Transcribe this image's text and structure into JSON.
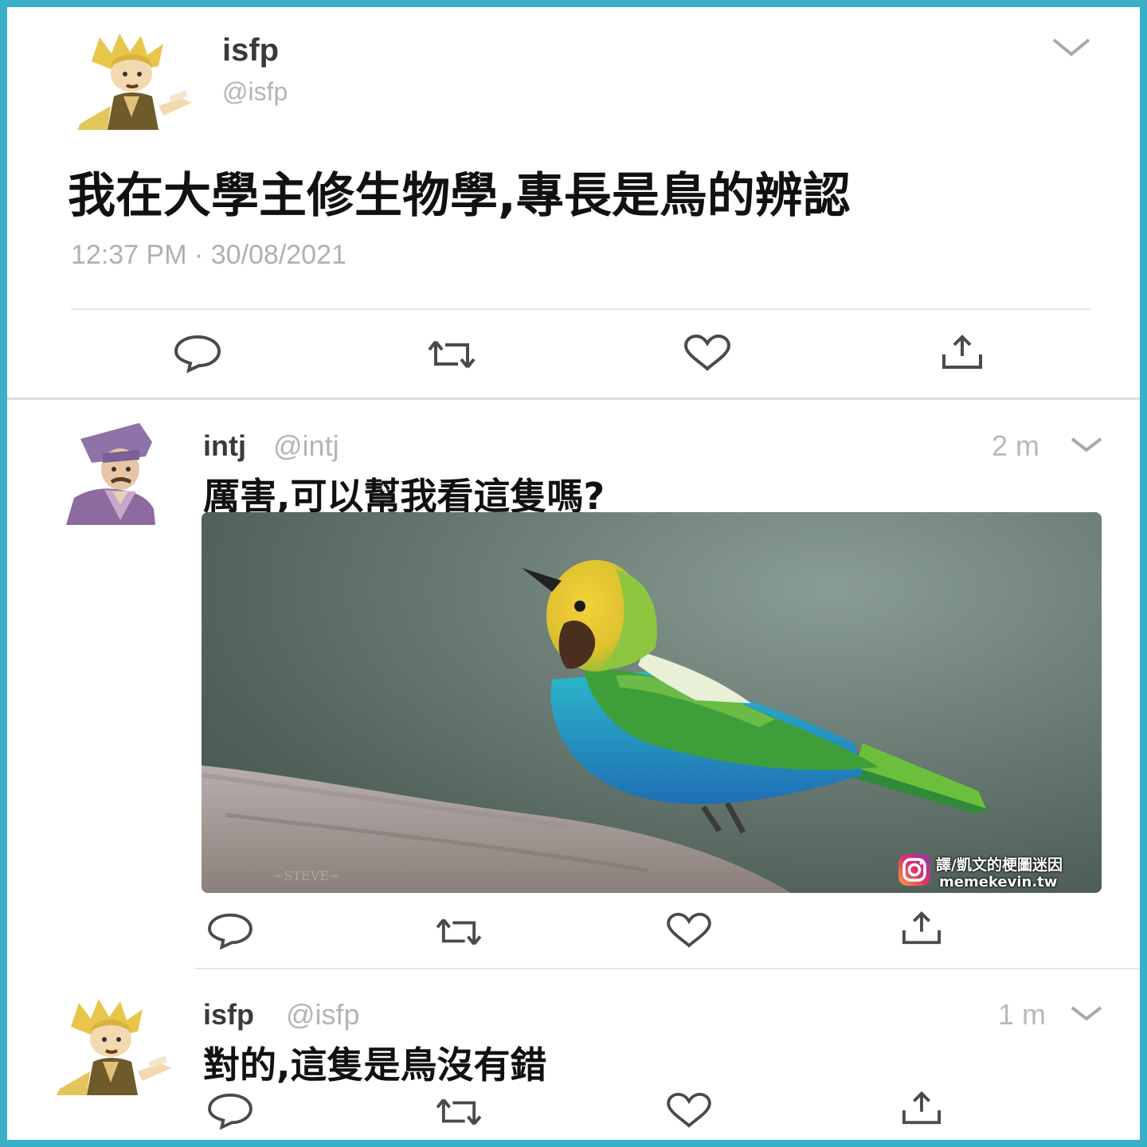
{
  "tweets": [
    {
      "name": "isfp",
      "handle": "@isfp",
      "text": "我在大學主修生物學,專長是鳥的辨認",
      "timestamp": "12:37 PM · 30/08/2021",
      "avatar_icon": "cartoon-man-blond-avatar-icon"
    },
    {
      "name": "intj",
      "handle": "@intj",
      "time": "2 m",
      "text": "厲害,可以幫我看這隻嗎?",
      "avatar_icon": "cartoon-man-purple-avatar-icon",
      "image": {
        "subject": "colorful bird on branch",
        "watermark_line1": "譯/凱文的梗圖迷因",
        "watermark_line2": "memekevin.tw"
      }
    },
    {
      "name": "isfp",
      "handle": "@isfp",
      "time": "1 m",
      "text": "對的,這隻是鳥沒有錯",
      "avatar_icon": "cartoon-man-blond-avatar-icon"
    }
  ],
  "actions": [
    "reply-icon",
    "retweet-icon",
    "like-icon",
    "share-icon"
  ],
  "colors": {
    "frame": "#3ab0c8",
    "icon": "#4a4a4a",
    "muted": "#b0b0b0"
  }
}
